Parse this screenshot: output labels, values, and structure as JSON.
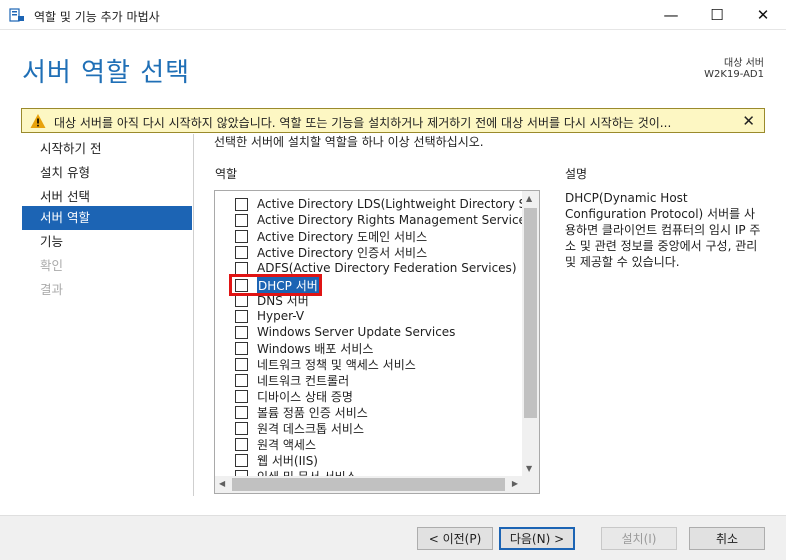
{
  "window": {
    "title": "역할 및 기능 추가 마법사",
    "controls": {
      "minimize": "—",
      "maximize": "☐",
      "close": "✕"
    }
  },
  "header": {
    "page_title": "서버 역할 선택",
    "target_label": "대상 서버",
    "target_server": "W2K19-AD1"
  },
  "warning": {
    "text": "대상 서버를 아직 다시 시작하지 않았습니다. 역할 또는 기능을 설치하거나 제거하기 전에 대상 서버를 다시 시작하는 것이...",
    "close": "✕",
    "icon_color": "#e8a20c"
  },
  "nav": {
    "items": [
      {
        "label": "시작하기 전",
        "state": "normal"
      },
      {
        "label": "설치 유형",
        "state": "normal"
      },
      {
        "label": "서버 선택",
        "state": "normal"
      },
      {
        "label": "서버 역할",
        "state": "active"
      },
      {
        "label": "기능",
        "state": "normal"
      },
      {
        "label": "확인",
        "state": "disabled"
      },
      {
        "label": "결과",
        "state": "disabled"
      }
    ]
  },
  "main": {
    "instruction": "선택한 서버에 설치할 역할을 하나 이상 선택하십시오.",
    "roles_label": "역할",
    "roles": [
      "Active Directory LDS(Lightweight Directory Servic",
      "Active Directory Rights Management Services",
      "Active Directory 도메인 서비스",
      "Active Directory 인증서 서비스",
      "ADFS(Active Directory Federation Services)",
      "DHCP 서버",
      "DNS 서버",
      "Hyper-V",
      "Windows Server Update Services",
      "Windows 배포 서비스",
      "네트워크 정책 및 액세스 서비스",
      "네트워크 컨트롤러",
      "디바이스 상태 증명",
      "볼륨 정품 인증 서비스",
      "원격 데스크톱 서비스",
      "원격 액세스",
      "웹 서버(IIS)",
      "인쇄 및 문서 서비스"
    ],
    "selected_role": "DHCP 서버",
    "description_label": "설명",
    "description": "DHCP(Dynamic Host Configuration Protocol) 서버를 사용하면 클라이언트 컴퓨터의 임시 IP 주소 및 관련 정보를 중앙에서 구성, 관리 및 제공할 수 있습니다."
  },
  "footer": {
    "prev": "< 이전(P)",
    "next": "다음(N) >",
    "install": "설치(I)",
    "cancel": "취소"
  },
  "colors": {
    "accent": "#1c64b4",
    "title_blue": "#1f6fb6",
    "highlight_red": "#e01414",
    "warning_bg": "#fdf7c3"
  }
}
